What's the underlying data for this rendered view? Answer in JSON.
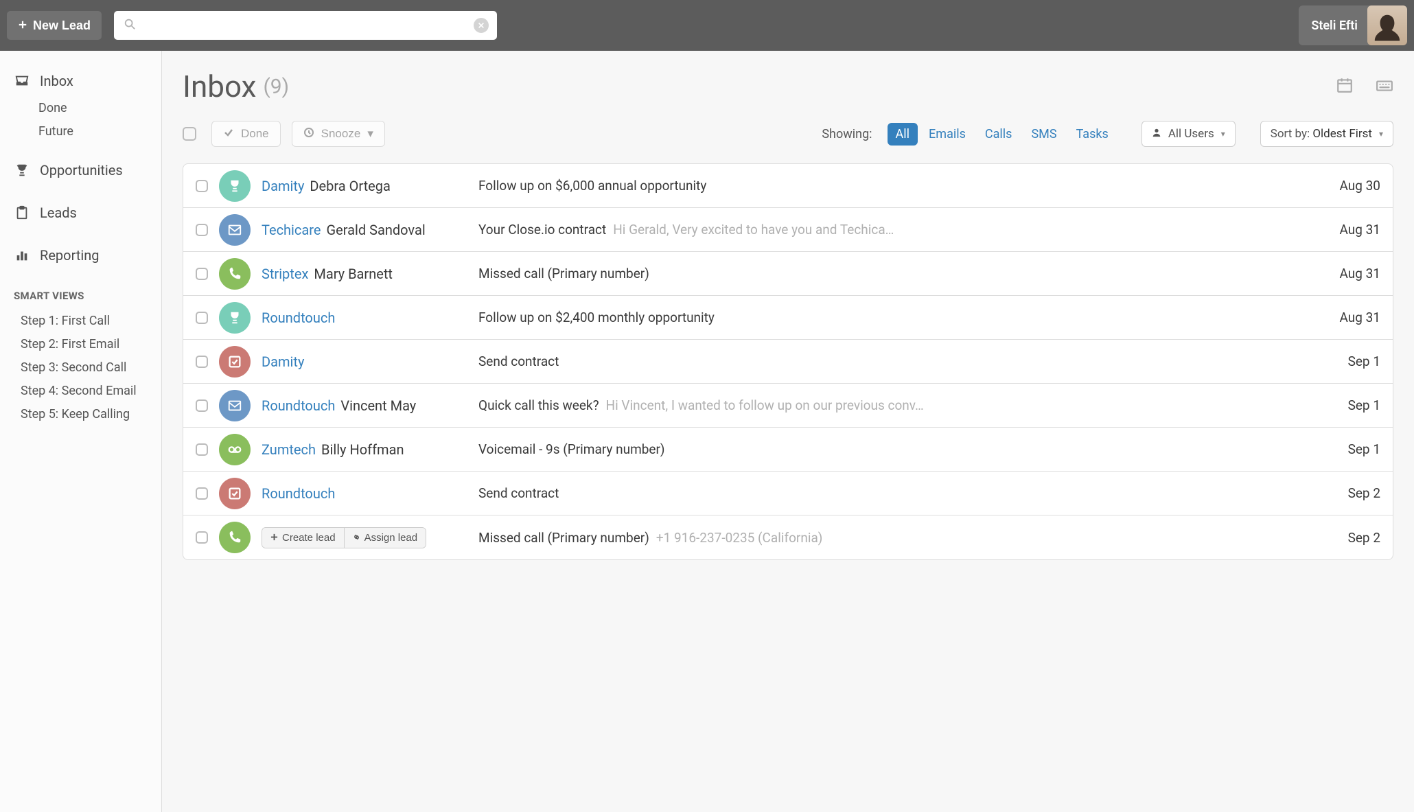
{
  "topbar": {
    "new_lead_label": "New Lead",
    "search_placeholder": "",
    "user_name": "Steli Efti"
  },
  "sidebar": {
    "inbox_label": "Inbox",
    "done_label": "Done",
    "future_label": "Future",
    "opportunities_label": "Opportunities",
    "leads_label": "Leads",
    "reporting_label": "Reporting",
    "smart_views_header": "SMART VIEWS",
    "smart_views": [
      "Step 1: First Call",
      "Step 2: First Email",
      "Step 3: Second Call",
      "Step 4: Second Email",
      "Step 5: Keep Calling"
    ]
  },
  "page": {
    "title": "Inbox",
    "count": "(9)"
  },
  "toolbar": {
    "done_label": "Done",
    "snooze_label": "Snooze",
    "showing_label": "Showing:",
    "filters": {
      "all": "All",
      "emails": "Emails",
      "calls": "Calls",
      "sms": "SMS",
      "tasks": "Tasks"
    },
    "all_users_label": "All Users",
    "sort_prefix": "Sort by: ",
    "sort_value": "Oldest First"
  },
  "row_actions": {
    "create_lead": "Create lead",
    "assign_lead": "Assign lead"
  },
  "rows": [
    {
      "type": "opportunity",
      "lead": "Damity",
      "contact": "Debra Ortega",
      "subject": "Follow up on $6,000 annual opportunity",
      "preview": "",
      "date": "Aug 30"
    },
    {
      "type": "email",
      "lead": "Techicare",
      "contact": "Gerald Sandoval",
      "subject": "Your Close.io contract",
      "preview": "Hi Gerald, Very excited to have you and Techica…",
      "date": "Aug 31"
    },
    {
      "type": "call",
      "lead": "Striptex",
      "contact": "Mary Barnett",
      "subject": "Missed call (Primary number)",
      "preview": "",
      "date": "Aug 31"
    },
    {
      "type": "opportunity",
      "lead": "Roundtouch",
      "contact": "",
      "subject": "Follow up on $2,400 monthly opportunity",
      "preview": "",
      "date": "Aug 31"
    },
    {
      "type": "task",
      "lead": "Damity",
      "contact": "",
      "subject": "Send contract",
      "preview": "",
      "date": "Sep 1"
    },
    {
      "type": "email",
      "lead": "Roundtouch",
      "contact": "Vincent May",
      "subject": "Quick call this week?",
      "preview": "Hi Vincent, I wanted to follow up on our previous conv…",
      "date": "Sep 1"
    },
    {
      "type": "voicemail",
      "lead": "Zumtech",
      "contact": "Billy Hoffman",
      "subject": "Voicemail - 9s (Primary number)",
      "preview": "",
      "date": "Sep 1"
    },
    {
      "type": "task",
      "lead": "Roundtouch",
      "contact": "",
      "subject": "Send contract",
      "preview": "",
      "date": "Sep 2"
    },
    {
      "type": "call",
      "lead": "",
      "contact": "",
      "has_actions": true,
      "subject": "Missed call (Primary number)",
      "preview": "+1 916-237-0235 (California)",
      "date": "Sep 2"
    }
  ]
}
